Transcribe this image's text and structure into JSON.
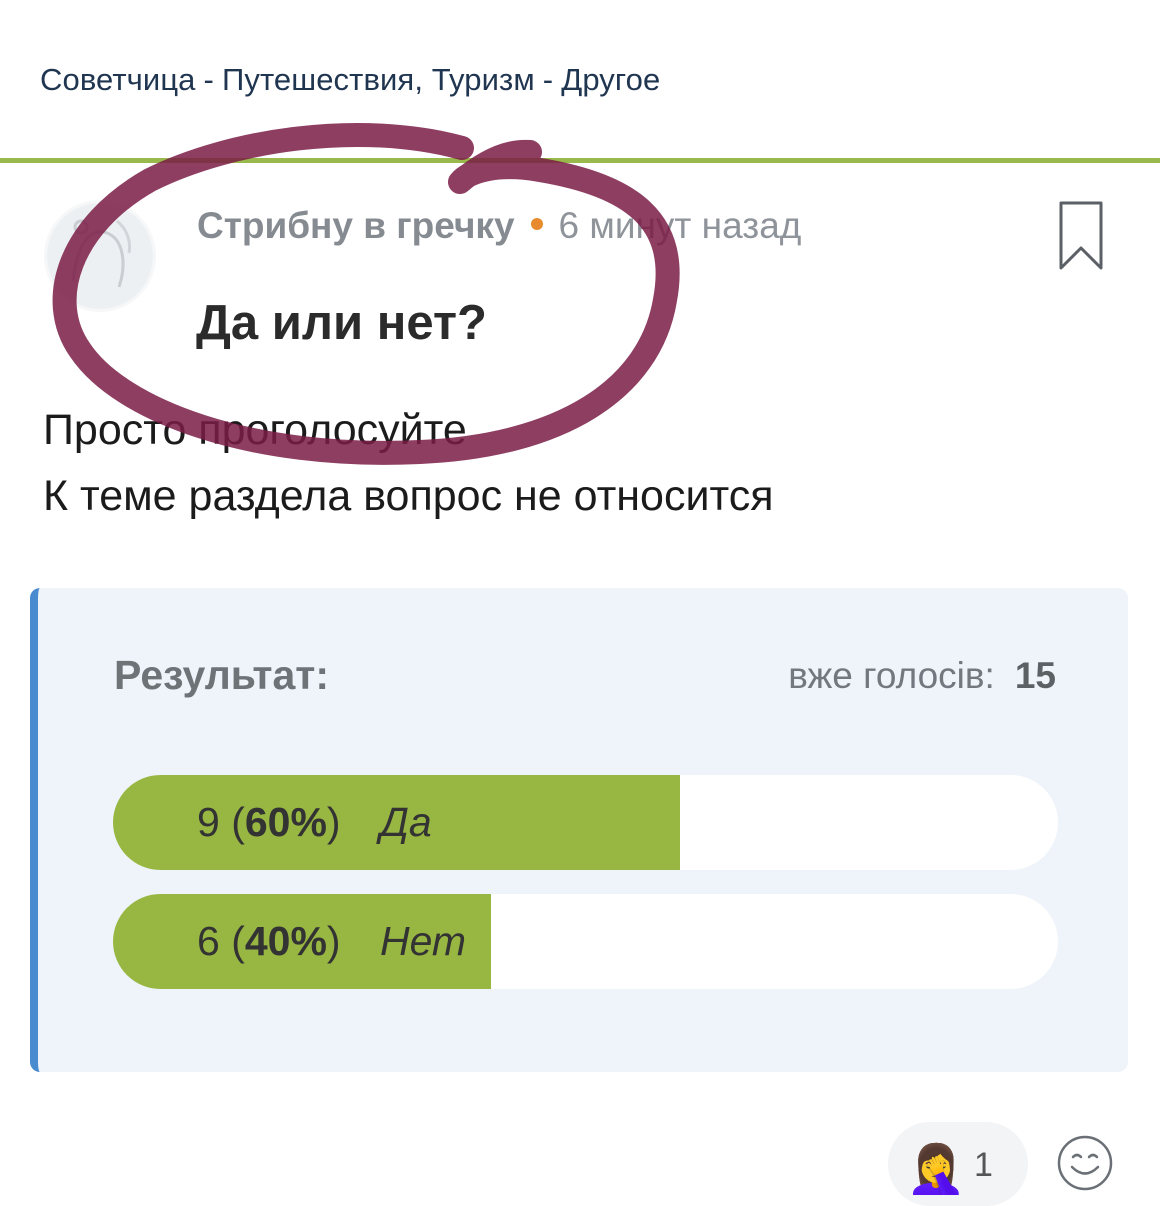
{
  "breadcrumb": {
    "items": [
      "Советчица",
      "Путешествия, Туризм",
      "Другое"
    ],
    "separator": "-"
  },
  "post": {
    "author": "Стрибну в гречку",
    "time": "6 минут назад",
    "title": "Да или нет?",
    "body_lines": [
      "Просто проголосуйте",
      "К теме раздела вопрос не относится"
    ]
  },
  "poll": {
    "label": "Результат:",
    "votes_label": "вже голосів:",
    "votes_total": "15",
    "options": [
      {
        "count": "9",
        "percent": "60%",
        "fraction": 0.6,
        "label": "Да"
      },
      {
        "count": "6",
        "percent": "40%",
        "fraction": 0.4,
        "label": "Нет"
      }
    ]
  },
  "reactions": {
    "emoji": "🤦‍♀️",
    "count": "1"
  },
  "colors": {
    "accent_green": "#97b642",
    "divider_green": "#9ab94d",
    "poll_border_blue": "#4a8bd0",
    "meta_dot_orange": "#e88a2e",
    "scribble_maroon": "#7a1c45"
  },
  "icons": {
    "bookmark": "bookmark-icon",
    "smile": "smiley-icon",
    "avatar": "avatar-image"
  }
}
